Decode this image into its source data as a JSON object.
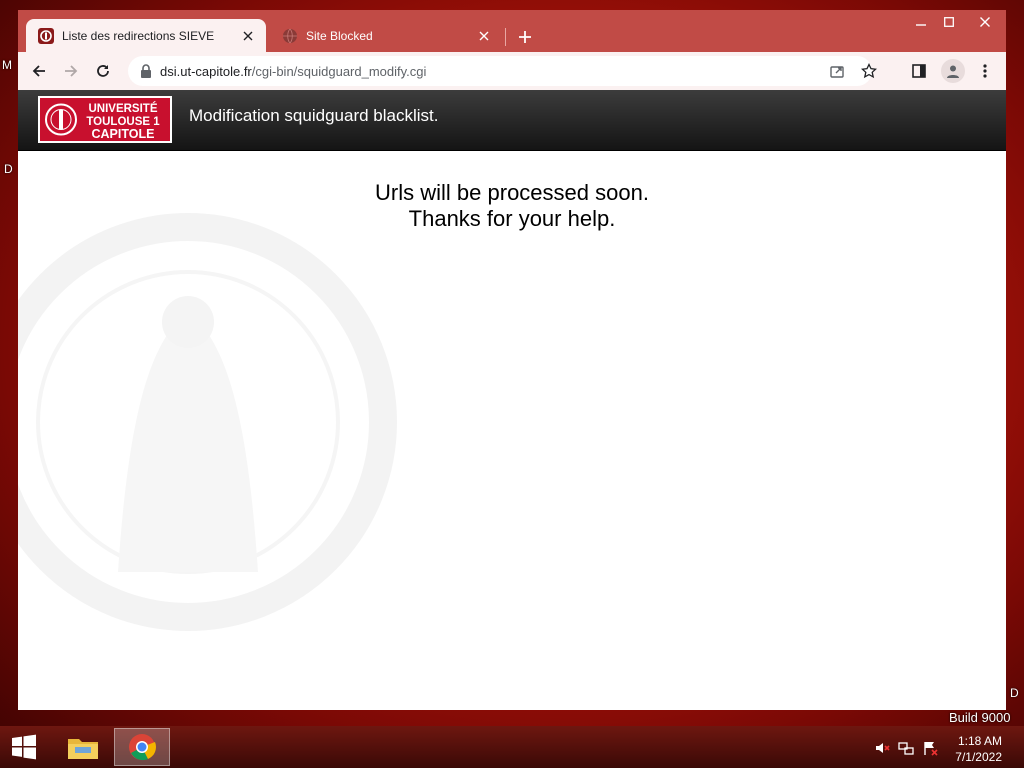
{
  "desktop": {
    "fragment_left_top": "M",
    "fragment_left_mid": "D",
    "fragment_right": "D",
    "build_text": "Build 9000"
  },
  "browser": {
    "tabs": [
      {
        "title": "Liste des redirections SIEVE",
        "active": true,
        "favicon": "sieve-icon"
      },
      {
        "title": "Site Blocked",
        "active": false,
        "favicon": "globe-icon"
      }
    ],
    "url_host": "dsi.ut-capitole.fr",
    "url_path": "/cgi-bin/squidguard_modify.cgi"
  },
  "page": {
    "logo": {
      "line1": "UNIVERSITÉ",
      "line2": "TOULOUSE 1",
      "line3": "CAPITOLE"
    },
    "header_title": "Modification squidguard blacklist.",
    "message_line1": "Urls will be processed soon.",
    "message_line2": "Thanks for your help."
  },
  "taskbar": {
    "time": "1:18 AM",
    "date": "7/1/2022"
  },
  "colors": {
    "titlebar": "#c14b46",
    "toolbar": "#fbf1f1",
    "brand_red": "#c8102e"
  }
}
